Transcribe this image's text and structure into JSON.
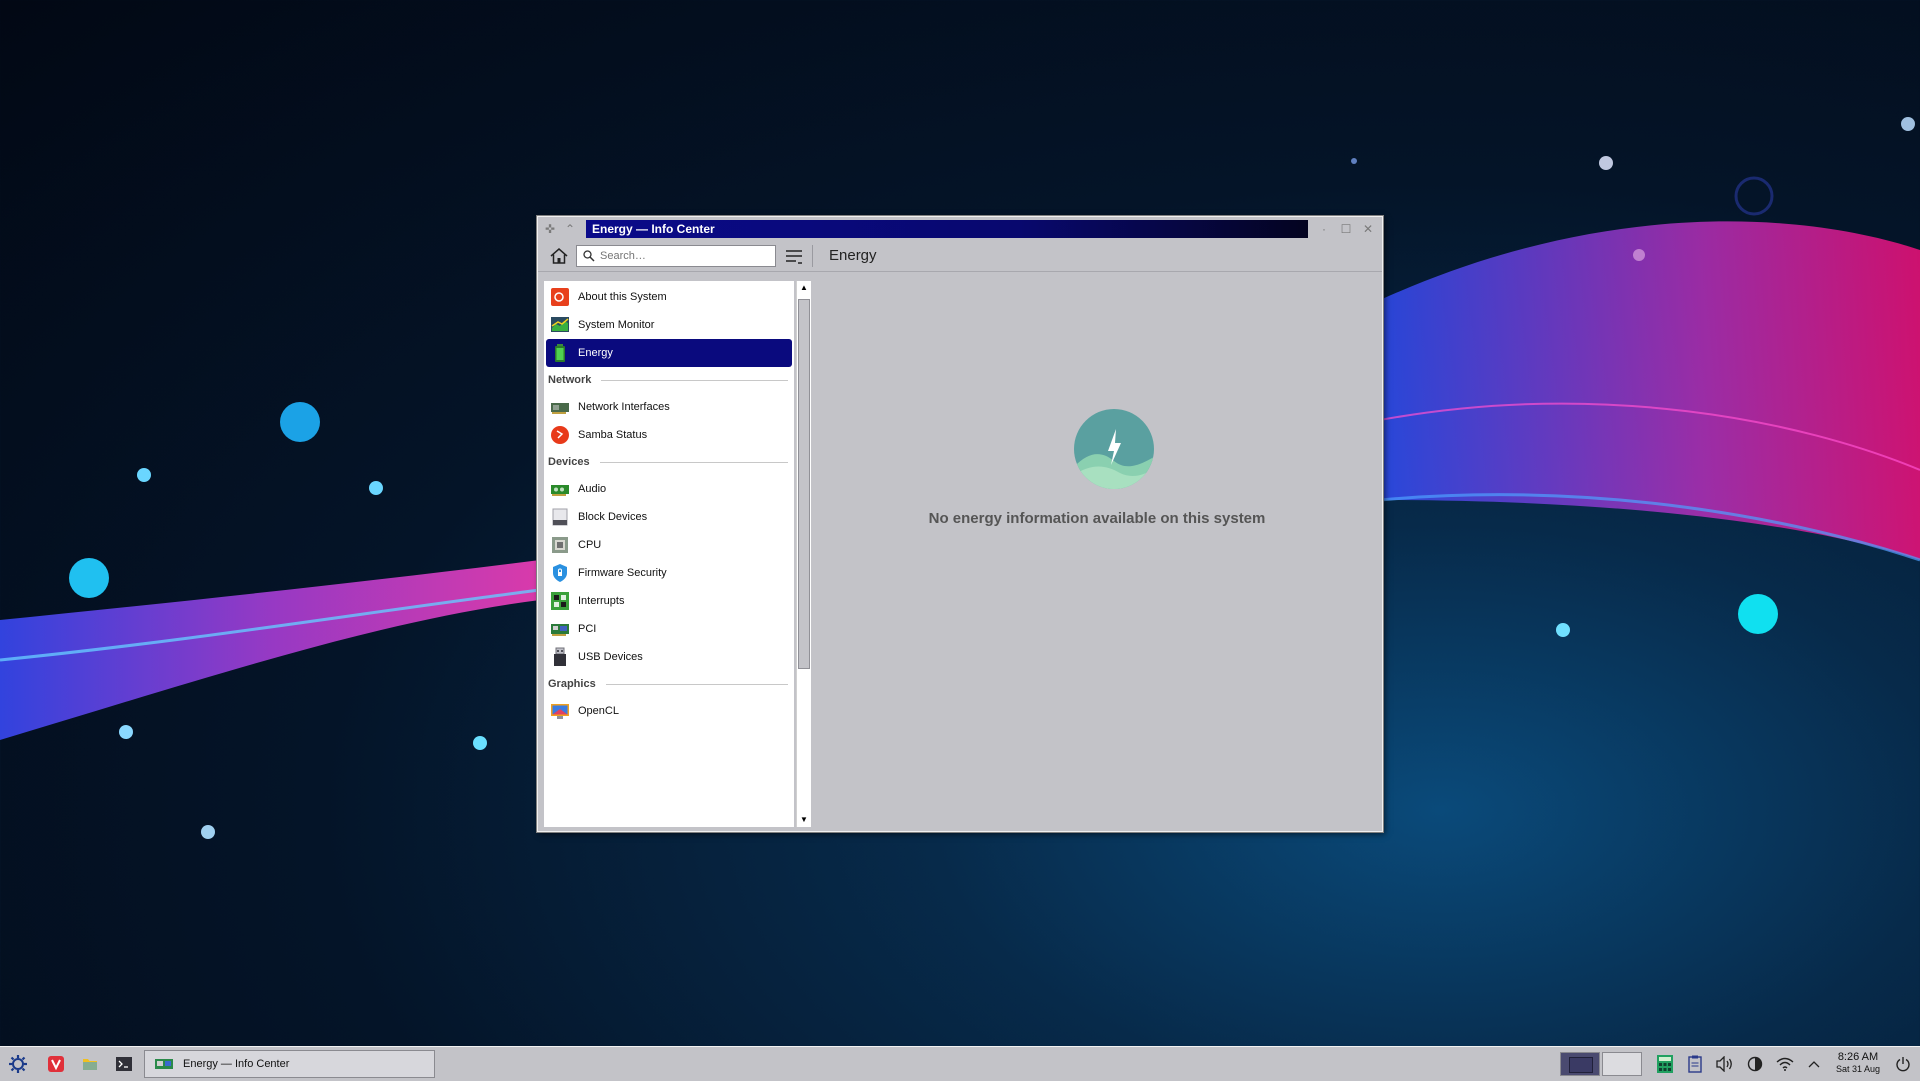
{
  "window": {
    "title": "Energy — Info Center",
    "page_title": "Energy",
    "search_placeholder": "Search…"
  },
  "sidebar": {
    "items": [
      {
        "label": "About this System",
        "icon": "about-system-icon"
      },
      {
        "label": "System Monitor",
        "icon": "system-monitor-icon"
      },
      {
        "label": "Energy",
        "icon": "battery-icon",
        "selected": true
      }
    ],
    "sections": [
      {
        "title": "Network",
        "items": [
          {
            "label": "Network Interfaces",
            "icon": "network-card-icon"
          },
          {
            "label": "Samba Status",
            "icon": "samba-icon"
          }
        ]
      },
      {
        "title": "Devices",
        "items": [
          {
            "label": "Audio",
            "icon": "audio-card-icon"
          },
          {
            "label": "Block Devices",
            "icon": "drive-icon"
          },
          {
            "label": "CPU",
            "icon": "cpu-icon"
          },
          {
            "label": "Firmware Security",
            "icon": "shield-icon"
          },
          {
            "label": "Interrupts",
            "icon": "interrupts-icon"
          },
          {
            "label": "PCI",
            "icon": "pci-card-icon"
          },
          {
            "label": "USB Devices",
            "icon": "usb-icon"
          }
        ]
      },
      {
        "title": "Graphics",
        "items": [
          {
            "label": "OpenCL",
            "icon": "opencl-icon"
          }
        ]
      }
    ]
  },
  "content": {
    "message": "No energy information available on this system",
    "icon": "energy-placeholder-icon"
  },
  "taskbar": {
    "task_label": "Energy — Info Center",
    "clock_time": "8:26 AM",
    "clock_date": "Sat 31 Aug"
  },
  "colors": {
    "selection": "#0a0a7e",
    "window_bg": "#c3c3c8",
    "title_gradient_start": "#0a0a8a"
  }
}
